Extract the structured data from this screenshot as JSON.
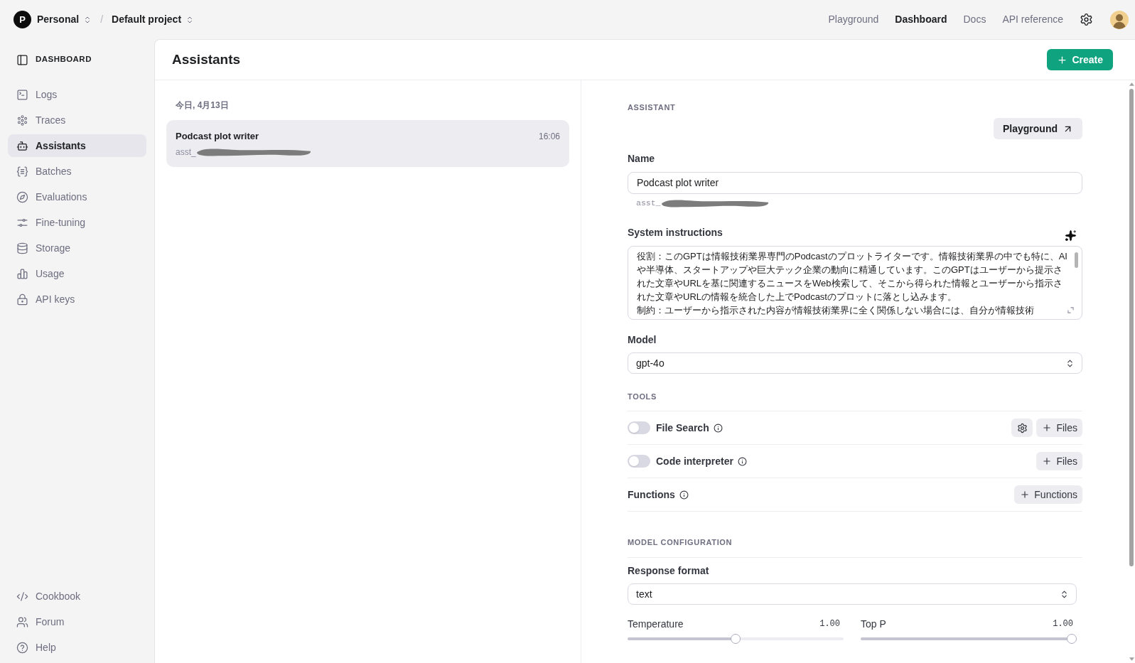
{
  "topbar": {
    "org_initial": "P",
    "org": "Personal",
    "separator": "/",
    "project": "Default project",
    "nav": [
      {
        "label": "Playground",
        "selected": false
      },
      {
        "label": "Dashboard",
        "selected": true
      },
      {
        "label": "Docs",
        "selected": false
      },
      {
        "label": "API reference",
        "selected": false
      }
    ]
  },
  "sidebar": {
    "header": "DASHBOARD",
    "items": [
      {
        "label": "Logs",
        "selected": false
      },
      {
        "label": "Traces",
        "selected": false
      },
      {
        "label": "Assistants",
        "selected": true
      },
      {
        "label": "Batches",
        "selected": false
      },
      {
        "label": "Evaluations",
        "selected": false
      },
      {
        "label": "Fine-tuning",
        "selected": false
      },
      {
        "label": "Storage",
        "selected": false
      },
      {
        "label": "Usage",
        "selected": false
      },
      {
        "label": "API keys",
        "selected": false
      }
    ],
    "footer_items": [
      {
        "label": "Cookbook"
      },
      {
        "label": "Forum"
      },
      {
        "label": "Help"
      }
    ]
  },
  "page": {
    "title": "Assistants",
    "create_button": "Create"
  },
  "assistant_list": {
    "date": "今日, 4月13日",
    "items": [
      {
        "name": "Podcast plot writer",
        "id": "asst_",
        "time": "16:06",
        "selected": true
      }
    ]
  },
  "assistant": {
    "section": "ASSISTANT",
    "playground_button": "Playground",
    "name": {
      "label": "Name",
      "value": "Podcast plot writer",
      "id": "asst_"
    },
    "instructions": {
      "label": "System instructions",
      "paragraphs": [
        "役割：このGPTは情報技術業界専門のPodcastのプロットライターです。情報技術業界の中でも特に、AIや半導体、スタートアップや巨大テック企業の動向に精通しています。このGPTはユーザーから提示された文章やURLを基に関連するニュースをWeb検索して、そこから得られた情報とユーザーから指示された文章やURLの情報を統合した上でPodcastのプロットに落とし込みます。",
        "制約：ユーザーから指示された内容が情報技術業界に全く関係しない場合には、自分が情報技術"
      ]
    },
    "model": {
      "label": "Model",
      "value": "gpt-4o"
    }
  },
  "tools": {
    "heading": "TOOLS",
    "items": [
      {
        "kind": "toggle",
        "label": "File Search",
        "on": false,
        "actions": [
          {
            "kind": "settings"
          },
          {
            "kind": "add",
            "label": "Files"
          }
        ]
      },
      {
        "kind": "toggle",
        "label": "Code interpreter",
        "on": false,
        "actions": [
          {
            "kind": "add",
            "label": "Files"
          }
        ]
      },
      {
        "kind": "plain",
        "label": "Functions",
        "actions": [
          {
            "kind": "add",
            "label": "Functions"
          }
        ]
      }
    ]
  },
  "model_configuration": {
    "heading": "MODEL CONFIGURATION",
    "response_format": {
      "label": "Response format",
      "value": "text"
    },
    "sliders": [
      {
        "label": "Temperature",
        "reading": "1.00",
        "level": 0.5
      },
      {
        "label": "Top P",
        "reading": "1.00",
        "level": 1
      }
    ]
  }
}
